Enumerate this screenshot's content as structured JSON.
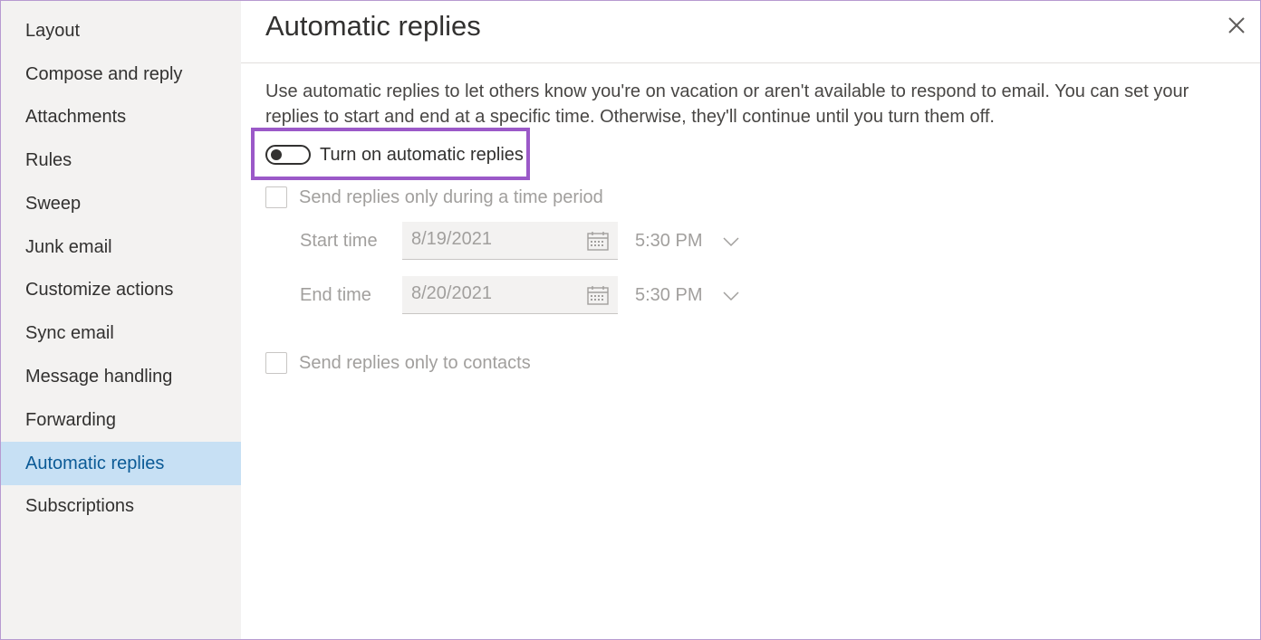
{
  "sidebar": {
    "items": [
      {
        "label": "Layout"
      },
      {
        "label": "Compose and reply"
      },
      {
        "label": "Attachments"
      },
      {
        "label": "Rules"
      },
      {
        "label": "Sweep"
      },
      {
        "label": "Junk email"
      },
      {
        "label": "Customize actions"
      },
      {
        "label": "Sync email"
      },
      {
        "label": "Message handling"
      },
      {
        "label": "Forwarding"
      },
      {
        "label": "Automatic replies",
        "active": true
      },
      {
        "label": "Subscriptions"
      }
    ]
  },
  "header": {
    "title": "Automatic replies",
    "close_icon": "close-icon"
  },
  "main": {
    "description": "Use automatic replies to let others know you're on vacation or aren't available to respond to email. You can set your replies to start and end at a specific time. Otherwise, they'll continue until you turn them off.",
    "toggle": {
      "label": "Turn on automatic replies",
      "on": false
    },
    "time_period": {
      "label": "Send replies only during a time period",
      "checked": false
    },
    "start": {
      "label": "Start time",
      "date": "8/19/2021",
      "time": "5:30 PM"
    },
    "end": {
      "label": "End time",
      "date": "8/20/2021",
      "time": "5:30 PM"
    },
    "contacts_only": {
      "label": "Send replies only to contacts",
      "checked": false
    }
  },
  "colors": {
    "sidebar_bg": "#f3f2f1",
    "active_bg": "#c7e0f4",
    "active_text": "#0b5a96",
    "highlight": "#9b59c8",
    "disabled_text": "#a19f9d"
  }
}
